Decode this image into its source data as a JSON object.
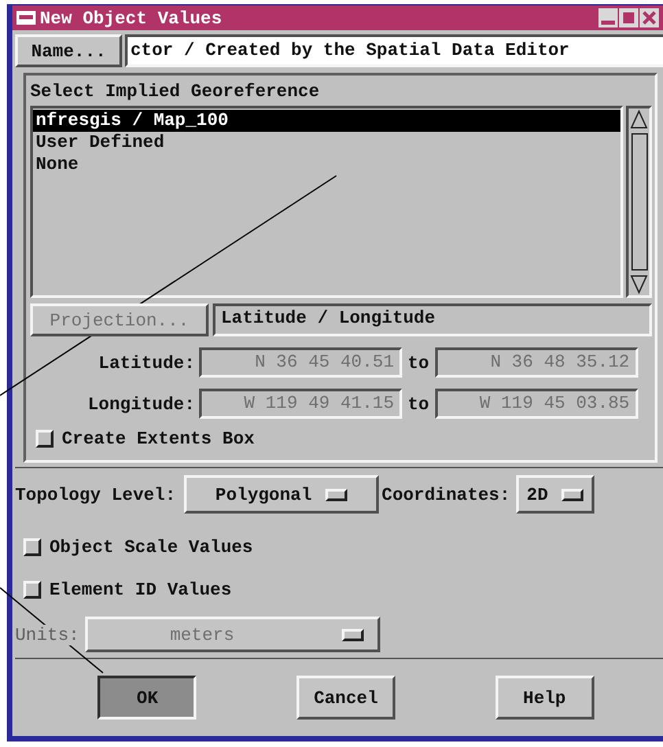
{
  "window": {
    "title": "New Object Values"
  },
  "name": {
    "button": "Name...",
    "value": "ctor / Created by the Spatial Data Editor"
  },
  "georeference": {
    "title": "Select Implied Georeference",
    "items": [
      {
        "label": "nfresgis / Map_100",
        "selected": true
      },
      {
        "label": "User Defined",
        "selected": false
      },
      {
        "label": "None",
        "selected": false
      }
    ]
  },
  "projection": {
    "button": "Projection...",
    "disabled": true,
    "value": "Latitude / Longitude"
  },
  "extents": [
    {
      "label": "Latitude:",
      "from": "N 36 45 40.51",
      "to_label": "to",
      "to": "N 36 48 35.12",
      "disabled": true
    },
    {
      "label": "Longitude:",
      "from": "W 119 49 41.15",
      "to_label": "to",
      "to": "W 119 45 03.85",
      "disabled": true
    }
  ],
  "create_extents_box": {
    "label": "Create Extents Box",
    "checked": false
  },
  "topology": {
    "label": "Topology Level:",
    "value": "Polygonal"
  },
  "coordinates": {
    "label": "Coordinates:",
    "value": "2D"
  },
  "options": [
    {
      "label": "Object Scale Values",
      "checked": false
    },
    {
      "label": "Element ID Values",
      "checked": false
    }
  ],
  "units": {
    "label": "Units:",
    "value": "meters",
    "disabled": true
  },
  "buttons": [
    {
      "label": "OK",
      "pressed": true
    },
    {
      "label": "Cancel",
      "pressed": false
    },
    {
      "label": "Help",
      "pressed": false
    }
  ]
}
